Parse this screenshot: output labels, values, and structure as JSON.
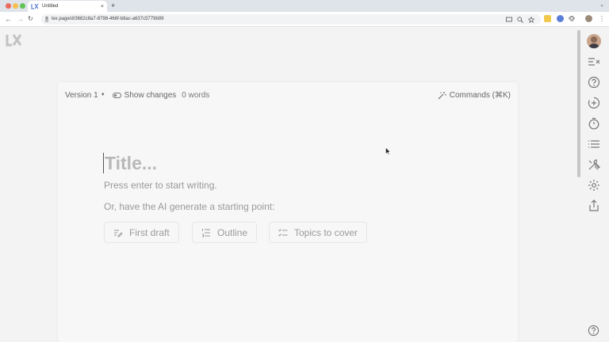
{
  "browser": {
    "tab_title": "Untitled",
    "url": "lex.page/d/3682c8a7-8798-466f-b8ac-a637c5779b99",
    "traffic_colors": [
      "#ed6a5e",
      "#f5bf4f",
      "#61c554"
    ]
  },
  "editor": {
    "version_label": "Version 1",
    "show_changes_label": "Show changes",
    "word_count": "0 words",
    "commands_label": "Commands (⌘K)",
    "title_placeholder": "Title...",
    "hint": "Press enter to start writing.",
    "ai_prompt": "Or, have the AI generate a starting point:",
    "ai_buttons": [
      {
        "label": "First draft",
        "icon": "pencil-lines-icon"
      },
      {
        "label": "Outline",
        "icon": "numbered-list-icon"
      },
      {
        "label": "Topics to cover",
        "icon": "checklist-icon"
      }
    ]
  },
  "sidebar": {
    "icons": [
      "avatar",
      "compare-icon",
      "help-icon",
      "add-comment-icon",
      "timer-icon",
      "list-icon",
      "tools-icon",
      "gear-icon",
      "share-icon"
    ]
  }
}
